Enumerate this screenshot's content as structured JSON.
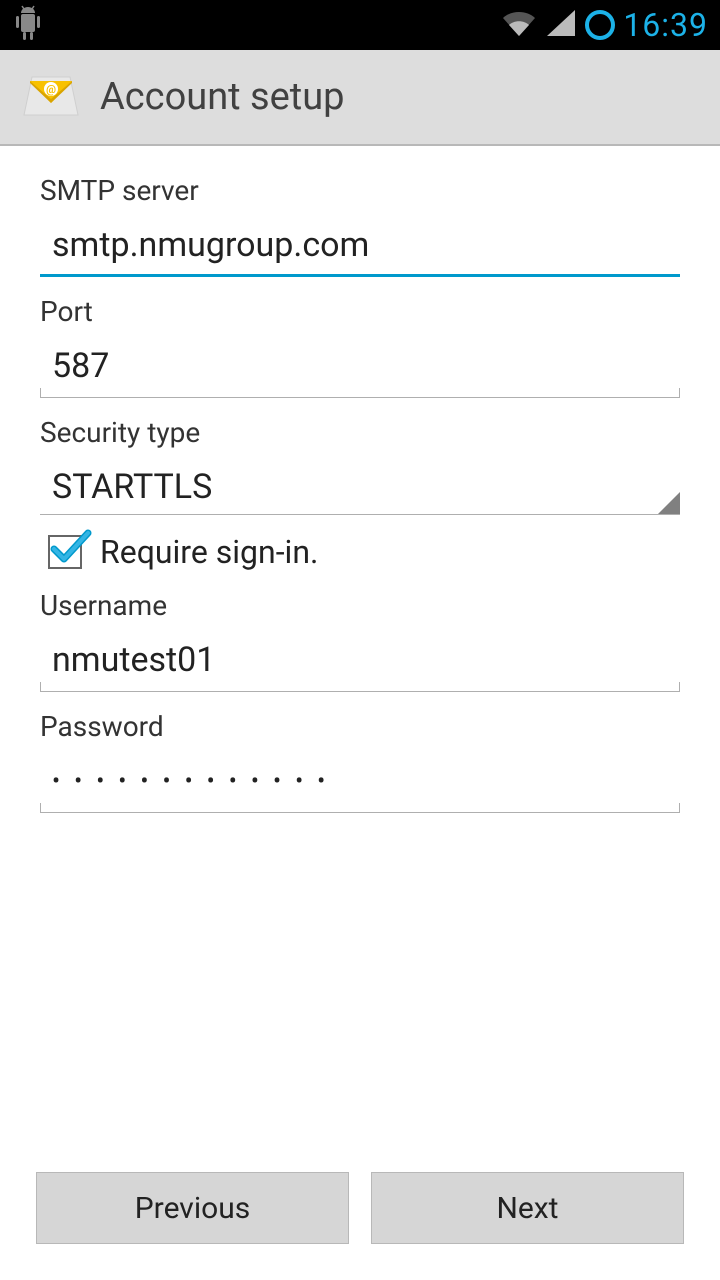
{
  "status": {
    "time": "16:39"
  },
  "header": {
    "title": "Account setup"
  },
  "form": {
    "smtp_label": "SMTP server",
    "smtp_value": "smtp.nmugroup.com",
    "port_label": "Port",
    "port_value": "587",
    "security_label": "Security type",
    "security_value": "STARTTLS",
    "require_signin_label": "Require sign-in.",
    "require_signin_checked": true,
    "username_label": "Username",
    "username_value": "nmutest01",
    "password_label": "Password",
    "password_value": "•••••••••••••"
  },
  "buttons": {
    "previous": "Previous",
    "next": "Next"
  }
}
